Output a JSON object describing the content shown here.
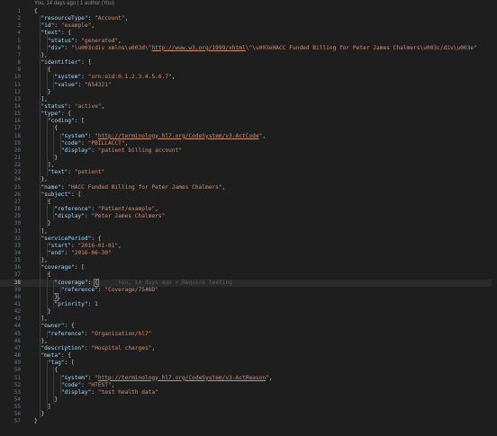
{
  "blame_header": "You, 14 days ago | 1 author (You)",
  "inline_blame": "You, 14 days ago • Require Testing",
  "active_line": "38",
  "lines": [
    {
      "n": "1",
      "t": [
        [
          "p",
          "{"
        ]
      ]
    },
    {
      "n": "2",
      "t": [
        [
          "p",
          "  "
        ],
        [
          "k",
          "\"resourceType\""
        ],
        [
          "p",
          ": "
        ],
        [
          "s",
          "\"Account\""
        ],
        [
          "p",
          ","
        ]
      ]
    },
    {
      "n": "3",
      "t": [
        [
          "p",
          "  "
        ],
        [
          "k",
          "\"id\""
        ],
        [
          "p",
          ": "
        ],
        [
          "s",
          "\"example\""
        ],
        [
          "p",
          ","
        ]
      ]
    },
    {
      "n": "4",
      "t": [
        [
          "p",
          "  "
        ],
        [
          "k",
          "\"text\""
        ],
        [
          "p",
          ": {"
        ]
      ]
    },
    {
      "n": "5",
      "t": [
        [
          "p",
          "    "
        ],
        [
          "k",
          "\"status\""
        ],
        [
          "p",
          ": "
        ],
        [
          "s",
          "\"generated\""
        ],
        [
          "p",
          ","
        ]
      ]
    },
    {
      "n": "6",
      "t": [
        [
          "p",
          "    "
        ],
        [
          "k",
          "\"div\""
        ],
        [
          "p",
          ": "
        ],
        [
          "s",
          "\"\\u003cdiv xmlns\\u003d\\\""
        ],
        [
          "su",
          "http://www.w3.org/1999/xhtml"
        ],
        [
          "s",
          "\\\"\\u003eHACC Funded Billing for Peter James Chalmers\\u003c/div\\u003e\""
        ]
      ]
    },
    {
      "n": "7",
      "t": [
        [
          "p",
          "  },"
        ]
      ]
    },
    {
      "n": "8",
      "t": [
        [
          "p",
          "  "
        ],
        [
          "k",
          "\"identifier\""
        ],
        [
          "p",
          ": ["
        ]
      ]
    },
    {
      "n": "9",
      "t": [
        [
          "p",
          "    {"
        ]
      ]
    },
    {
      "n": "10",
      "t": [
        [
          "p",
          "      "
        ],
        [
          "k",
          "\"system\""
        ],
        [
          "p",
          ": "
        ],
        [
          "s",
          "\"urn:oid:0.1.2.3.4.5.6.7\""
        ],
        [
          "p",
          ","
        ]
      ]
    },
    {
      "n": "11",
      "t": [
        [
          "p",
          "      "
        ],
        [
          "k",
          "\"value\""
        ],
        [
          "p",
          ": "
        ],
        [
          "s",
          "\"654321\""
        ]
      ]
    },
    {
      "n": "12",
      "t": [
        [
          "p",
          "    }"
        ]
      ]
    },
    {
      "n": "13",
      "t": [
        [
          "p",
          "  ],"
        ]
      ]
    },
    {
      "n": "14",
      "t": [
        [
          "p",
          "  "
        ],
        [
          "k",
          "\"status\""
        ],
        [
          "p",
          ": "
        ],
        [
          "s",
          "\"active\""
        ],
        [
          "p",
          ","
        ]
      ]
    },
    {
      "n": "15",
      "t": [
        [
          "p",
          "  "
        ],
        [
          "k",
          "\"type\""
        ],
        [
          "p",
          ": {"
        ]
      ]
    },
    {
      "n": "16",
      "t": [
        [
          "p",
          "    "
        ],
        [
          "k",
          "\"coding\""
        ],
        [
          "p",
          ": ["
        ]
      ]
    },
    {
      "n": "17",
      "t": [
        [
          "p",
          "      {"
        ]
      ]
    },
    {
      "n": "18",
      "t": [
        [
          "p",
          "        "
        ],
        [
          "k",
          "\"system\""
        ],
        [
          "p",
          ": "
        ],
        [
          "s",
          "\""
        ],
        [
          "su",
          "http://terminology.hl7.org/CodeSystem/v3-ActCode"
        ],
        [
          "s",
          "\""
        ],
        [
          "p",
          ","
        ]
      ]
    },
    {
      "n": "19",
      "t": [
        [
          "p",
          "        "
        ],
        [
          "k",
          "\"code\""
        ],
        [
          "p",
          ": "
        ],
        [
          "s",
          "\"PBILLACCT\""
        ],
        [
          "p",
          ","
        ]
      ]
    },
    {
      "n": "20",
      "t": [
        [
          "p",
          "        "
        ],
        [
          "k",
          "\"display\""
        ],
        [
          "p",
          ": "
        ],
        [
          "s",
          "\"patient billing account\""
        ]
      ]
    },
    {
      "n": "21",
      "t": [
        [
          "p",
          "      }"
        ]
      ]
    },
    {
      "n": "22",
      "t": [
        [
          "p",
          "    ],"
        ]
      ]
    },
    {
      "n": "23",
      "t": [
        [
          "p",
          "    "
        ],
        [
          "k",
          "\"text\""
        ],
        [
          "p",
          ": "
        ],
        [
          "s",
          "\"patient\""
        ]
      ]
    },
    {
      "n": "24",
      "t": [
        [
          "p",
          "  },"
        ]
      ]
    },
    {
      "n": "25",
      "t": [
        [
          "p",
          "  "
        ],
        [
          "k",
          "\"name\""
        ],
        [
          "p",
          ": "
        ],
        [
          "s",
          "\"HACC Funded Billing for Peter James Chalmers\""
        ],
        [
          "p",
          ","
        ]
      ]
    },
    {
      "n": "26",
      "t": [
        [
          "p",
          "  "
        ],
        [
          "k",
          "\"subject\""
        ],
        [
          "p",
          ": ["
        ]
      ]
    },
    {
      "n": "27",
      "t": [
        [
          "p",
          "    {"
        ]
      ]
    },
    {
      "n": "28",
      "t": [
        [
          "p",
          "      "
        ],
        [
          "k",
          "\"reference\""
        ],
        [
          "p",
          ": "
        ],
        [
          "s",
          "\"Patient/example\""
        ],
        [
          "p",
          ","
        ]
      ]
    },
    {
      "n": "29",
      "t": [
        [
          "p",
          "      "
        ],
        [
          "k",
          "\"display\""
        ],
        [
          "p",
          ": "
        ],
        [
          "s",
          "\"Peter James Chalmers\""
        ]
      ]
    },
    {
      "n": "30",
      "t": [
        [
          "p",
          "    }"
        ]
      ]
    },
    {
      "n": "31",
      "t": [
        [
          "p",
          "  ],"
        ]
      ]
    },
    {
      "n": "32",
      "t": [
        [
          "p",
          "  "
        ],
        [
          "k",
          "\"servicePeriod\""
        ],
        [
          "p",
          ": {"
        ]
      ]
    },
    {
      "n": "33",
      "t": [
        [
          "p",
          "    "
        ],
        [
          "k",
          "\"start\""
        ],
        [
          "p",
          ": "
        ],
        [
          "s",
          "\"2016-01-01\""
        ],
        [
          "p",
          ","
        ]
      ]
    },
    {
      "n": "34",
      "t": [
        [
          "p",
          "    "
        ],
        [
          "k",
          "\"end\""
        ],
        [
          "p",
          ": "
        ],
        [
          "s",
          "\"2016-06-30\""
        ]
      ]
    },
    {
      "n": "35",
      "t": [
        [
          "p",
          "  },"
        ]
      ]
    },
    {
      "n": "36",
      "t": [
        [
          "p",
          "  "
        ],
        [
          "k",
          "\"coverage\""
        ],
        [
          "p",
          ": ["
        ]
      ]
    },
    {
      "n": "37",
      "t": [
        [
          "p",
          "    {"
        ]
      ]
    },
    {
      "n": "38",
      "t": [
        [
          "p",
          "      "
        ],
        [
          "k",
          "\"coverage\""
        ],
        [
          "p",
          ": "
        ],
        [
          "pc",
          "{"
        ],
        [
          "g",
          "      You, 14 days ago • Require Testing"
        ]
      ]
    },
    {
      "n": "39",
      "t": [
        [
          "p",
          "        "
        ],
        [
          "k",
          "\"reference\""
        ],
        [
          "p",
          ": "
        ],
        [
          "s",
          "\"Coverage/7546D\""
        ]
      ]
    },
    {
      "n": "40",
      "t": [
        [
          "p",
          "      "
        ],
        [
          "pc",
          "}"
        ],
        [
          "p",
          ","
        ]
      ]
    },
    {
      "n": "41",
      "t": [
        [
          "p",
          "      "
        ],
        [
          "k",
          "\"priority\""
        ],
        [
          "p",
          ": "
        ],
        [
          "n",
          "1"
        ]
      ]
    },
    {
      "n": "42",
      "t": [
        [
          "p",
          "    }"
        ]
      ]
    },
    {
      "n": "43",
      "t": [
        [
          "p",
          "  ],"
        ]
      ]
    },
    {
      "n": "44",
      "t": [
        [
          "p",
          "  "
        ],
        [
          "k",
          "\"owner\""
        ],
        [
          "p",
          ": {"
        ]
      ]
    },
    {
      "n": "45",
      "t": [
        [
          "p",
          "    "
        ],
        [
          "k",
          "\"reference\""
        ],
        [
          "p",
          ": "
        ],
        [
          "s",
          "\"Organization/hl7\""
        ]
      ]
    },
    {
      "n": "46",
      "t": [
        [
          "p",
          "  },"
        ]
      ]
    },
    {
      "n": "47",
      "t": [
        [
          "p",
          "  "
        ],
        [
          "k",
          "\"description\""
        ],
        [
          "p",
          ": "
        ],
        [
          "s",
          "\"Hospital charges\""
        ],
        [
          "p",
          ","
        ]
      ]
    },
    {
      "n": "48",
      "t": [
        [
          "p",
          "  "
        ],
        [
          "k",
          "\"meta\""
        ],
        [
          "p",
          ": {"
        ]
      ]
    },
    {
      "n": "49",
      "t": [
        [
          "p",
          "    "
        ],
        [
          "k",
          "\"tag\""
        ],
        [
          "p",
          ": ["
        ]
      ]
    },
    {
      "n": "50",
      "t": [
        [
          "p",
          "      {"
        ]
      ]
    },
    {
      "n": "51",
      "t": [
        [
          "p",
          "        "
        ],
        [
          "k",
          "\"system\""
        ],
        [
          "p",
          ": "
        ],
        [
          "s",
          "\""
        ],
        [
          "su",
          "http://terminology.hl7.org/CodeSystem/v3-ActReason"
        ],
        [
          "s",
          "\""
        ],
        [
          "p",
          ","
        ]
      ]
    },
    {
      "n": "52",
      "t": [
        [
          "p",
          "        "
        ],
        [
          "k",
          "\"code\""
        ],
        [
          "p",
          ": "
        ],
        [
          "s",
          "\"HTEST\""
        ],
        [
          "p",
          ","
        ]
      ]
    },
    {
      "n": "53",
      "t": [
        [
          "p",
          "        "
        ],
        [
          "k",
          "\"display\""
        ],
        [
          "p",
          ": "
        ],
        [
          "s",
          "\"test health data\""
        ]
      ]
    },
    {
      "n": "54",
      "t": [
        [
          "p",
          "      }"
        ]
      ]
    },
    {
      "n": "55",
      "t": [
        [
          "p",
          "    ]"
        ]
      ]
    },
    {
      "n": "56",
      "t": [
        [
          "p",
          "  }"
        ]
      ]
    },
    {
      "n": "57",
      "t": [
        [
          "p",
          "}"
        ]
      ]
    }
  ]
}
